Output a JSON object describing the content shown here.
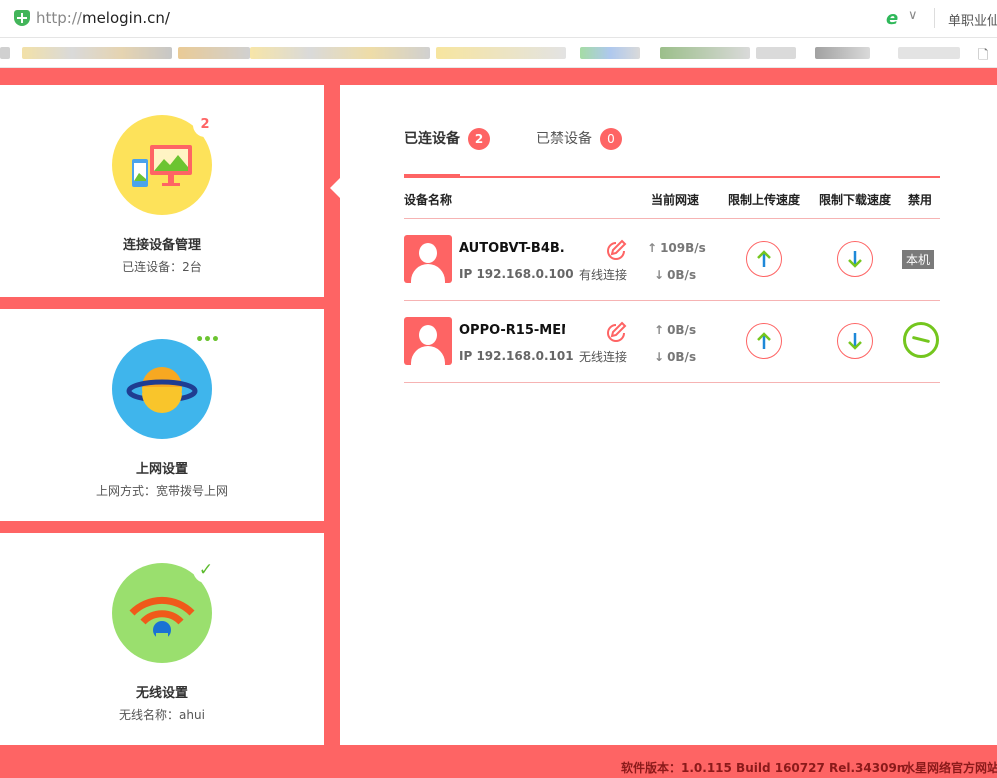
{
  "browser": {
    "url_prefix": "http://",
    "url_host": "melogin.cn/",
    "side_text": "单职业仙"
  },
  "sidebar": {
    "cards": [
      {
        "title": "连接设备管理",
        "subtitle": "已连设备：2台",
        "badge": "2"
      },
      {
        "title": "上网设置",
        "subtitle": "上网方式：宽带拨号上网",
        "badge": "•••"
      },
      {
        "title": "无线设置",
        "subtitle": "无线名称：ahui",
        "badge": "✓"
      }
    ]
  },
  "main": {
    "tabs": [
      {
        "label": "已连设备",
        "count": "2"
      },
      {
        "label": "已禁设备",
        "count": "0"
      }
    ],
    "columns": {
      "name": "设备名称",
      "speed": "当前网速",
      "upload_limit": "限制上传速度",
      "download_limit": "限制下载速度",
      "ban": "禁用"
    },
    "devices": [
      {
        "name": "AUTOBVT-B4B...",
        "ip": "IP 192.168.0.100",
        "connection": "有线连接",
        "up_speed": "109B/s",
        "down_speed": "0B/s",
        "status_label": "本机"
      },
      {
        "name": "OPPO-R15-MEN...",
        "ip": "IP 192.168.0.101",
        "connection": "无线连接",
        "up_speed": "0B/s",
        "down_speed": "0B/s"
      }
    ]
  },
  "footer": {
    "version": "软件版本：1.0.115 Build 160727 Rel.34309n",
    "site": "水星网络官方网站"
  },
  "colors": {
    "accent": "#fe6464",
    "green": "#74c61e",
    "blue_arrow": "#1e88d8"
  }
}
